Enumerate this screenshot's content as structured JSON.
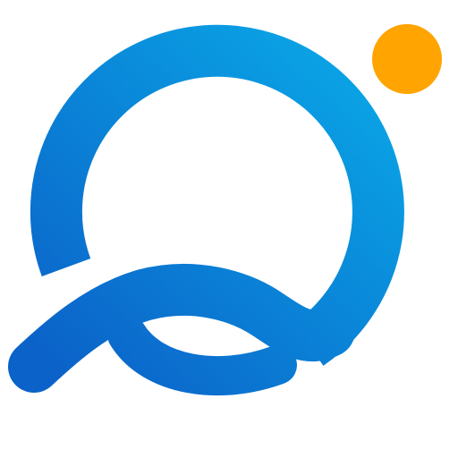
{
  "logo": {
    "name": "q-sun-logo",
    "colors": {
      "ring_light": "#0aa6e6",
      "ring_dark": "#0b63c9",
      "sun": "#ffa400",
      "background": "#ffffff"
    }
  }
}
